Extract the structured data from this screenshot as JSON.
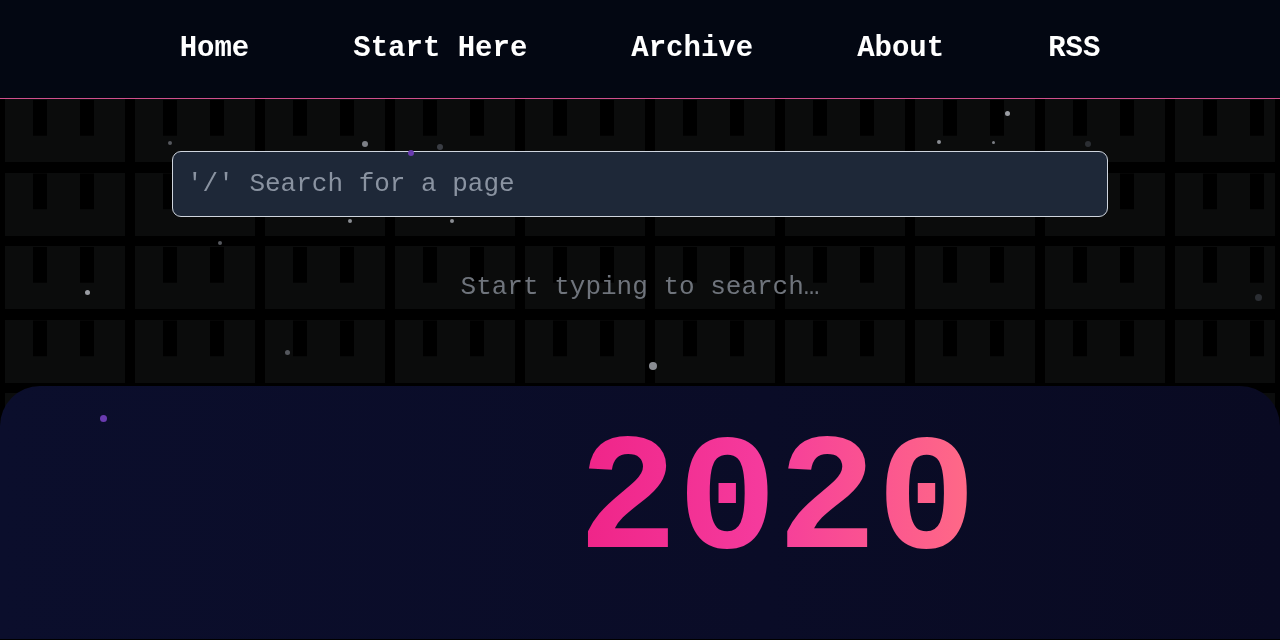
{
  "nav": {
    "links": [
      {
        "label": "Home"
      },
      {
        "label": "Start Here"
      },
      {
        "label": "Archive"
      },
      {
        "label": "About"
      },
      {
        "label": "RSS"
      }
    ]
  },
  "search": {
    "placeholder": "'/' Search for a page",
    "hint": "Start typing to search…"
  },
  "hero": {
    "title": "2020"
  }
}
